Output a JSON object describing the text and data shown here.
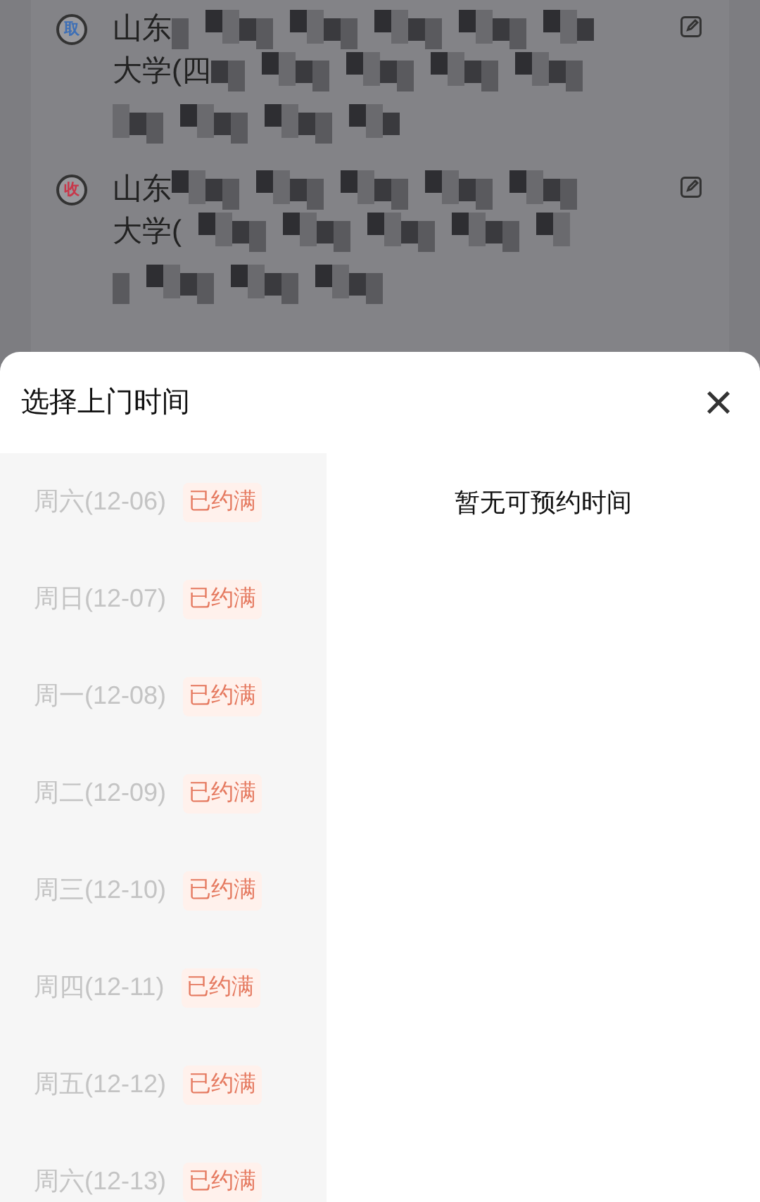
{
  "addresses": [
    {
      "badge": "取",
      "color": "#3d6fb6",
      "line_1": "山东",
      "line_2": "大学(四"
    },
    {
      "badge": "收",
      "color": "#c8374a",
      "line_1": "山东",
      "line_2": "大学("
    }
  ],
  "sheet": {
    "title": "选择上门时间",
    "close": "×",
    "dates": [
      {
        "label": "周六(12-06)",
        "status": "已约满"
      },
      {
        "label": "周日(12-07)",
        "status": "已约满"
      },
      {
        "label": "周一(12-08)",
        "status": "已约满"
      },
      {
        "label": "周二(12-09)",
        "status": "已约满"
      },
      {
        "label": "周三(12-10)",
        "status": "已约满"
      },
      {
        "label": "周四(12-11)",
        "status": "已约满"
      },
      {
        "label": "周五(12-12)",
        "status": "已约满"
      },
      {
        "label": "周六(12-13)",
        "status": "已约满"
      }
    ],
    "empty_message": "暂无可预约时间"
  }
}
